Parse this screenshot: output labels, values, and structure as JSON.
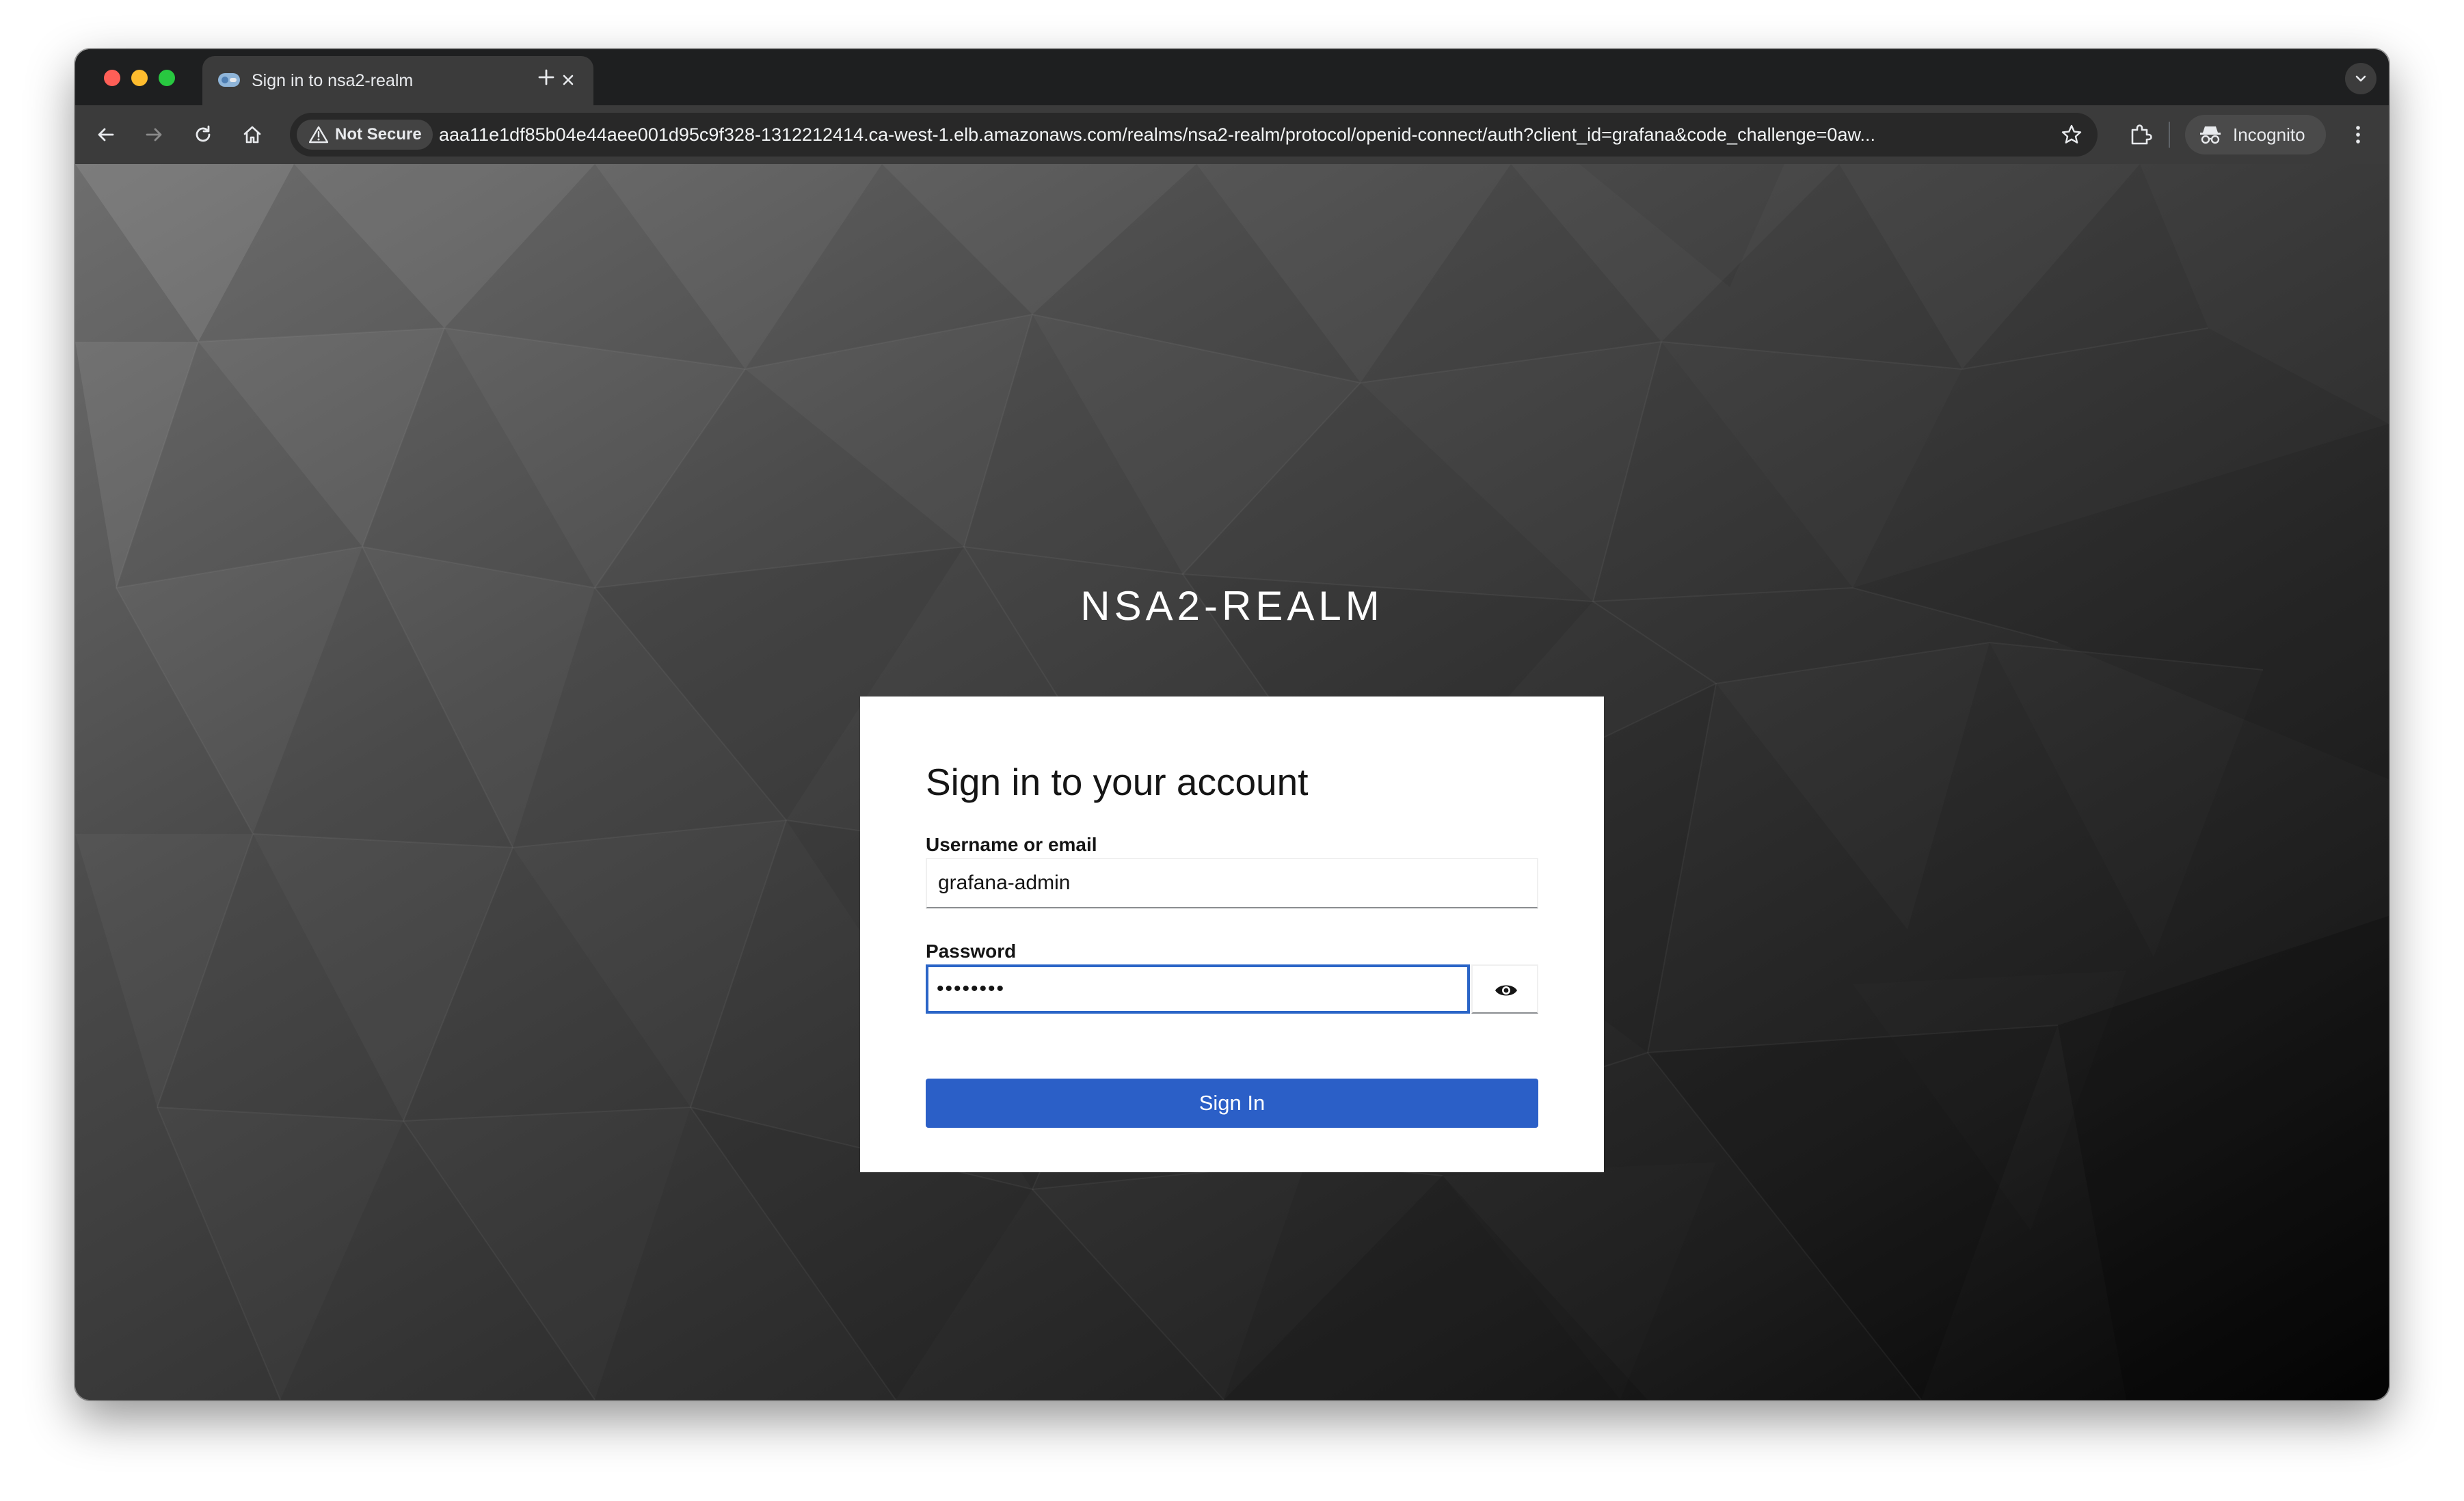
{
  "browser": {
    "tab": {
      "title": "Sign in to nsa2-realm"
    },
    "address_bar": {
      "security_chip": "Not Secure",
      "url": "aaa11e1df85b04e44aee001d95c9f328-1312212414.ca-west-1.elb.amazonaws.com/realms/nsa2-realm/protocol/openid-connect/auth?client_id=grafana&code_challenge=0aw..."
    },
    "profile": {
      "label": "Incognito"
    }
  },
  "page": {
    "realm_title": "NSA2-REALM",
    "card": {
      "heading": "Sign in to your account",
      "username_label": "Username or email",
      "username_value": "grafana-admin",
      "password_label": "Password",
      "password_value": "••••••••",
      "submit_label": "Sign In"
    }
  },
  "colors": {
    "primary_button": "#2b5fc7",
    "focus_border": "#2b65c7",
    "card_background": "#ffffff",
    "browser_toolbar": "#3b3b3b"
  },
  "icons": {
    "browser": [
      "back-arrow-icon",
      "forward-arrow-icon",
      "reload-icon",
      "home-icon",
      "warning-triangle-icon",
      "star-icon",
      "extensions-puzzle-icon",
      "incognito-icon",
      "menu-dots-icon",
      "tab-close-icon",
      "plus-icon",
      "chevron-down-icon"
    ],
    "form": [
      "eye-icon"
    ]
  }
}
